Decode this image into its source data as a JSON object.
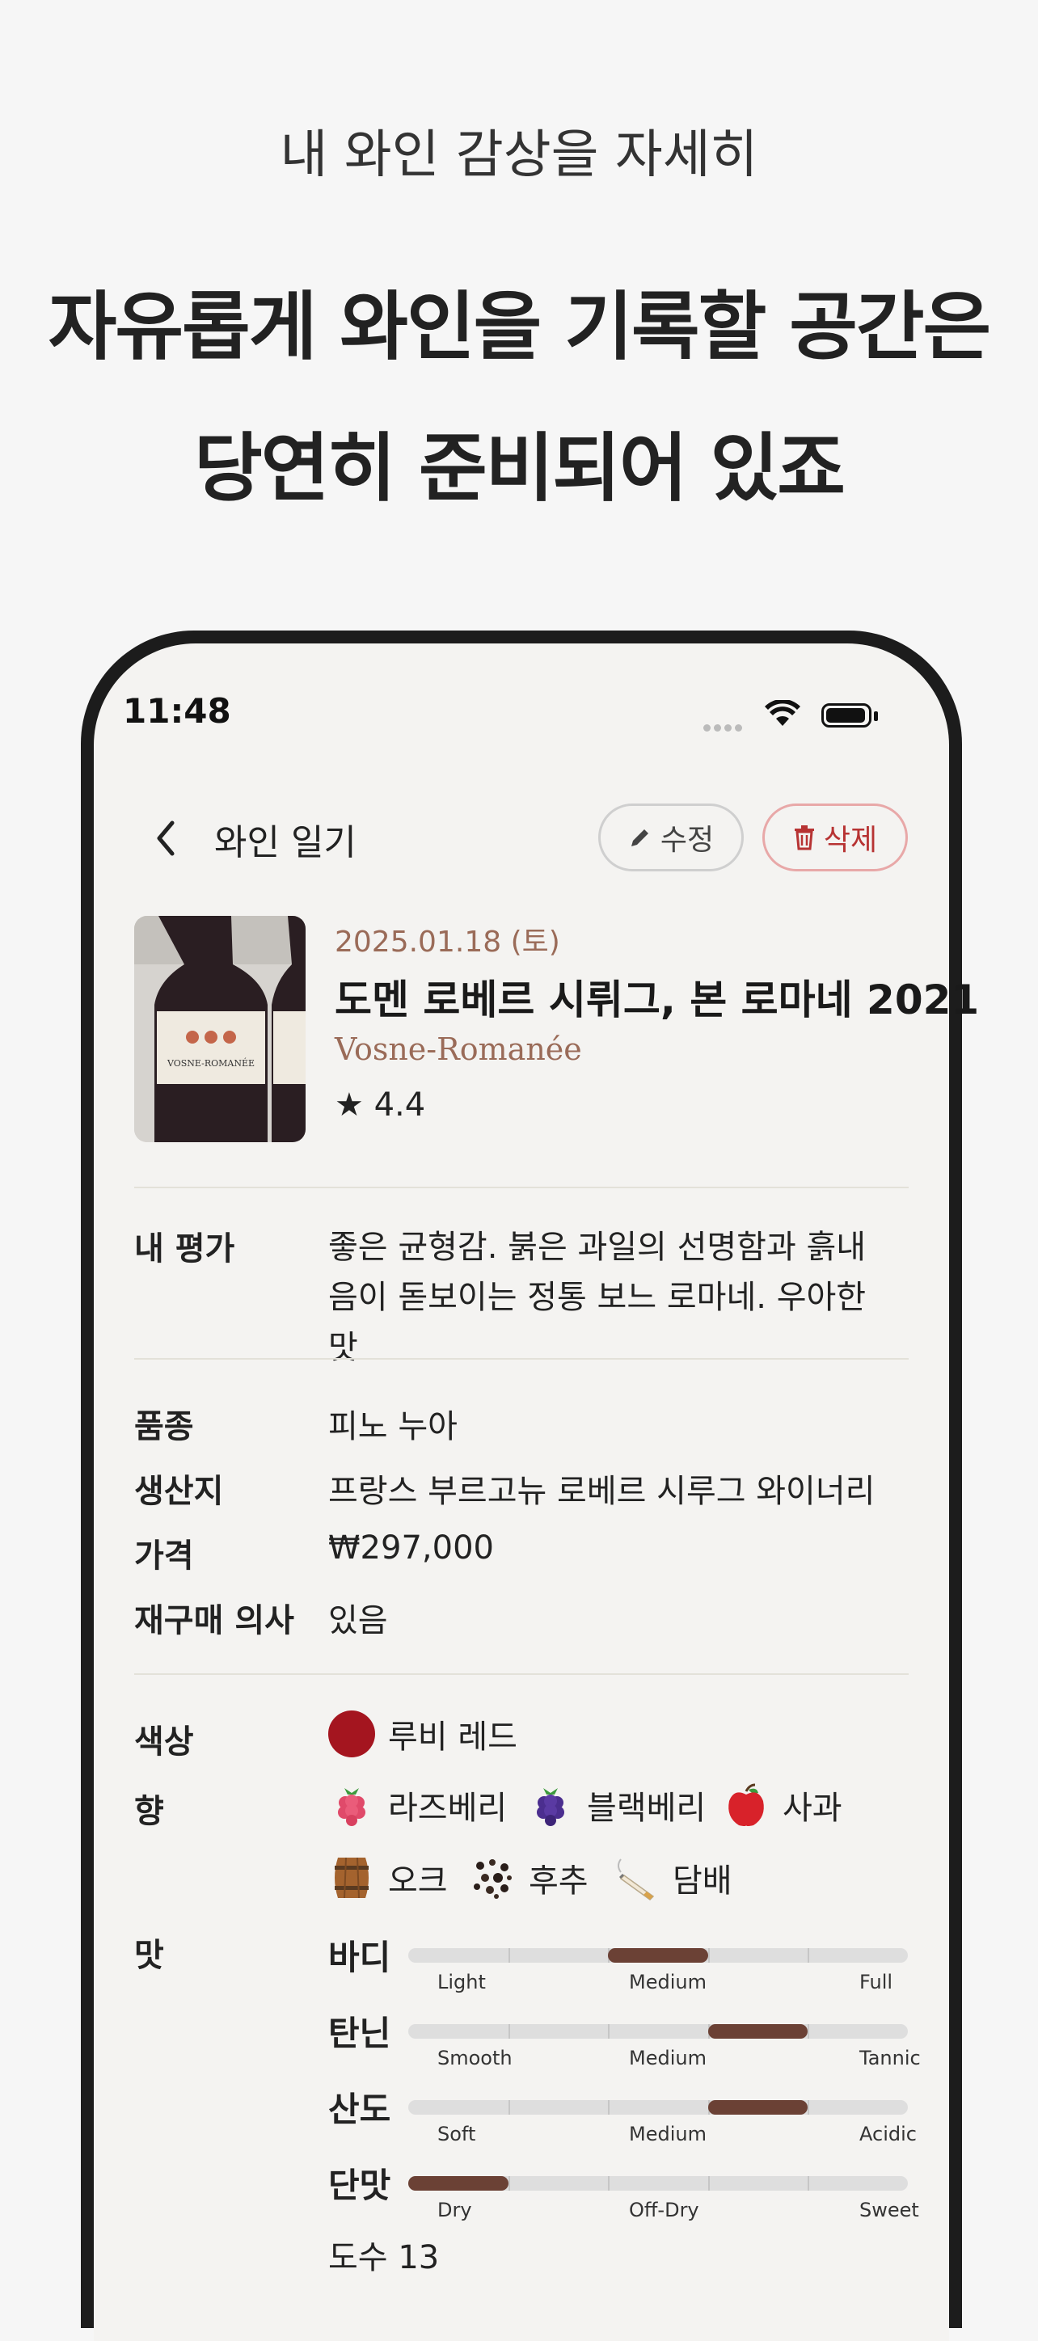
{
  "promo": {
    "subtitle": "내 와인 감상을 자세히",
    "headline_line1": "자유롭게 와인을 기록할 공간은",
    "headline_line2": "당연히 준비되어 있죠"
  },
  "status_bar": {
    "time": "11:48"
  },
  "nav": {
    "title": "와인 일기",
    "edit_label": "수정",
    "delete_label": "삭제"
  },
  "wine": {
    "date": "2025.01.18 (토)",
    "name": "도멘 로베르 시뤼그, 본 로마네 2021",
    "region": "Vosne-Romanée",
    "rating": "★ 4.4",
    "bottle_label": "VOSNE-ROMANÉE"
  },
  "review": {
    "label": "내 평가",
    "text": "좋은 균형감. 붉은 과일의 선명함과 흙내음이 돋보이는 정통 보느 로마네. 우아한 맛"
  },
  "details": [
    {
      "label": "품종",
      "value": "피노 누아"
    },
    {
      "label": "생산지",
      "value": "프랑스 부르고뉴 로베르 시루그 와이너리"
    },
    {
      "label": "가격",
      "value": "₩297,000"
    },
    {
      "label": "재구매 의사",
      "value": "있음"
    }
  ],
  "color": {
    "label": "색상",
    "value": "루비 레드",
    "swatch": "#a4151f"
  },
  "aroma": {
    "label": "향",
    "items": [
      {
        "name": "라즈베리",
        "icon": "raspberry-icon"
      },
      {
        "name": "블랙베리",
        "icon": "blackberry-icon"
      },
      {
        "name": "사과",
        "icon": "apple-icon"
      },
      {
        "name": "오크",
        "icon": "oak-barrel-icon"
      },
      {
        "name": "후추",
        "icon": "pepper-icon"
      },
      {
        "name": "담배",
        "icon": "tobacco-icon"
      }
    ]
  },
  "taste": {
    "label": "맛",
    "rows": [
      {
        "name": "바디",
        "left": "Light",
        "mid": "Medium",
        "right": "Full",
        "level": 3
      },
      {
        "name": "탄닌",
        "left": "Smooth",
        "mid": "Medium",
        "right": "Tannic",
        "level": 4
      },
      {
        "name": "산도",
        "left": "Soft",
        "mid": "Medium",
        "right": "Acidic",
        "level": 4
      },
      {
        "name": "단맛",
        "left": "Dry",
        "mid": "Off-Dry",
        "right": "Sweet",
        "level": 1
      }
    ],
    "scale_max": 5
  },
  "alcohol_partial": "도수 13"
}
